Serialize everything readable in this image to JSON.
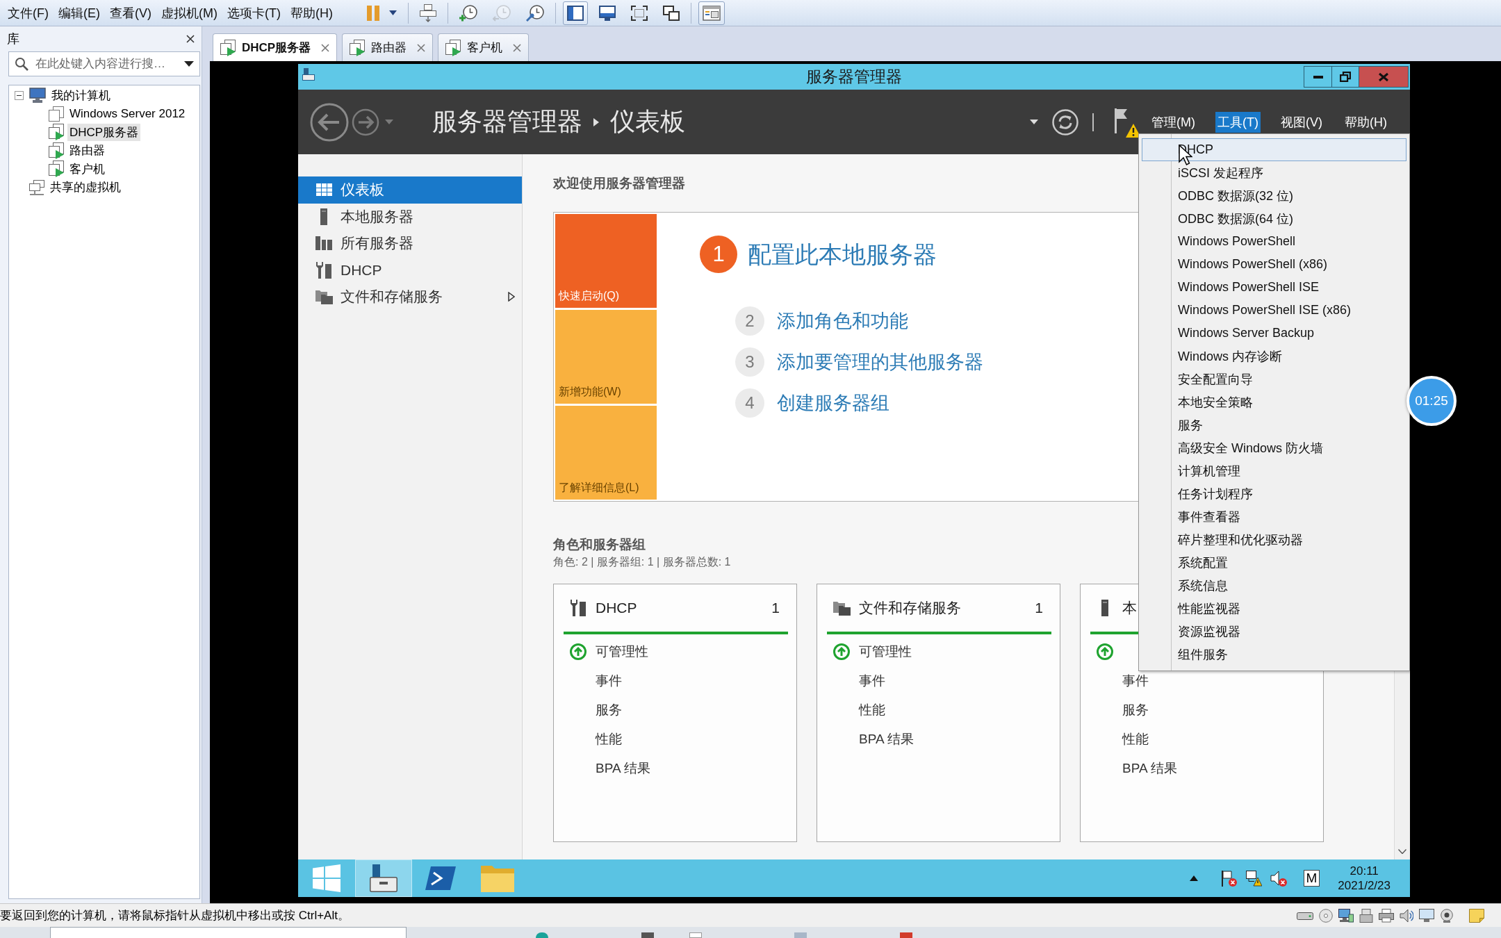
{
  "menu_bar": {
    "items": [
      "文件(F)",
      "编辑(E)",
      "查看(V)",
      "虚拟机(M)",
      "选项卡(T)",
      "帮助(H)"
    ]
  },
  "toolbar": {
    "groups": [
      {
        "buttons": [
          {
            "kind": "pause",
            "selected": false,
            "disabled": false
          }
        ]
      },
      {
        "buttons": [
          {
            "kind": "send-keys",
            "selected": false,
            "disabled": false
          }
        ]
      },
      {
        "buttons": [
          {
            "kind": "snapshot",
            "selected": false,
            "disabled": false
          },
          {
            "kind": "revert",
            "selected": false,
            "disabled": true
          },
          {
            "kind": "snapshot-manager",
            "selected": false,
            "disabled": false
          }
        ]
      },
      {
        "buttons": [
          {
            "kind": "console-view",
            "selected": true,
            "disabled": false
          },
          {
            "kind": "fit-guest",
            "selected": false,
            "disabled": false
          },
          {
            "kind": "full-screen",
            "selected": false,
            "disabled": false
          },
          {
            "kind": "unity",
            "selected": false,
            "disabled": false
          }
        ]
      },
      {
        "buttons": [
          {
            "kind": "thumbnail-bar",
            "selected": true,
            "disabled": false
          }
        ]
      }
    ]
  },
  "library": {
    "title": "库",
    "search": {
      "placeholder": "在此处键入内容进行搜…"
    },
    "tree": [
      {
        "label": "我的计算机",
        "kind": "computer",
        "expanded": true,
        "selected": false,
        "children": [
          {
            "label": "Windows Server 2012",
            "kind": "vm-off",
            "selected": false
          },
          {
            "label": "DHCP服务器",
            "kind": "vm-on",
            "selected": true
          },
          {
            "label": "路由器",
            "kind": "vm-on",
            "selected": false
          },
          {
            "label": "客户机",
            "kind": "vm-on",
            "selected": false
          }
        ]
      },
      {
        "label": "共享的虚拟机",
        "kind": "shared",
        "selected": false
      }
    ]
  },
  "tabs": [
    {
      "label": "DHCP服务器",
      "selected": true
    },
    {
      "label": "路由器",
      "selected": false
    },
    {
      "label": "客户机",
      "selected": false
    }
  ],
  "server_manager": {
    "title": "服务器管理器",
    "breadcrumb": [
      "服务器管理器",
      "仪表板"
    ],
    "notifications": {
      "warning": true
    },
    "menus": [
      {
        "label": "管理(M)",
        "selected": false
      },
      {
        "label": "工具(T)",
        "selected": true
      },
      {
        "label": "视图(V)",
        "selected": false
      },
      {
        "label": "帮助(H)",
        "selected": false
      }
    ],
    "nav": [
      {
        "label": "仪表板",
        "kind": "dashboard",
        "selected": true,
        "submenu": false
      },
      {
        "label": "本地服务器",
        "kind": "server",
        "selected": false,
        "submenu": false
      },
      {
        "label": "所有服务器",
        "kind": "servers",
        "selected": false,
        "submenu": false
      },
      {
        "label": "DHCP",
        "kind": "dhcp",
        "selected": false,
        "submenu": false
      },
      {
        "label": "文件和存储服务",
        "kind": "storage",
        "selected": false,
        "submenu": true
      }
    ],
    "welcome": {
      "title": "欢迎使用服务器管理器",
      "tabs": [
        {
          "label": "快速启动(Q)",
          "selected": true
        },
        {
          "label": "新增功能(W)",
          "selected": false
        },
        {
          "label": "了解详细信息(L)",
          "selected": false
        }
      ],
      "steps": [
        {
          "number": "1",
          "label": "配置此本地服务器",
          "selected": true
        },
        {
          "number": "2",
          "label": "添加角色和功能",
          "selected": false
        },
        {
          "number": "3",
          "label": "添加要管理的其他服务器",
          "selected": false
        },
        {
          "number": "4",
          "label": "创建服务器组",
          "selected": false
        }
      ]
    },
    "roles": {
      "title": "角色和服务器组",
      "summary": "角色: 2 | 服务器组: 1 | 服务器总数: 1",
      "tiles": [
        {
          "title": "DHCP",
          "kind": "dhcp",
          "count": "1",
          "healthy": true,
          "rows": [
            {
              "label": "可管理性",
              "ok": true
            },
            {
              "label": "事件",
              "ok": false
            },
            {
              "label": "服务",
              "ok": false
            },
            {
              "label": "性能",
              "ok": false
            },
            {
              "label": "BPA 结果",
              "ok": false
            }
          ]
        },
        {
          "title": "文件和存储服务",
          "kind": "storage",
          "count": "1",
          "healthy": true,
          "rows": [
            {
              "label": "可管理性",
              "ok": true
            },
            {
              "label": "事件",
              "ok": false
            },
            {
              "label": "性能",
              "ok": false
            },
            {
              "label": "BPA 结果",
              "ok": false
            }
          ]
        },
        {
          "title": "本",
          "kind": "server",
          "healthy": true,
          "rows": [
            {
              "ok": true
            },
            {
              "label": "事件",
              "ok": false
            },
            {
              "label": "服务",
              "ok": false
            },
            {
              "label": "性能",
              "ok": false
            },
            {
              "label": "BPA 结果",
              "ok": false
            }
          ]
        }
      ]
    },
    "tools_menu": [
      {
        "label": "DHCP",
        "selected": true
      },
      {
        "label": "iSCSI 发起程序",
        "selected": false
      },
      {
        "label": "ODBC 数据源(32 位)",
        "selected": false
      },
      {
        "label": "ODBC 数据源(64 位)",
        "selected": false
      },
      {
        "label": "Windows PowerShell",
        "selected": false
      },
      {
        "label": "Windows PowerShell (x86)",
        "selected": false
      },
      {
        "label": "Windows PowerShell ISE",
        "selected": false
      },
      {
        "label": "Windows PowerShell ISE (x86)",
        "selected": false
      },
      {
        "label": "Windows Server Backup",
        "selected": false
      },
      {
        "label": "Windows 内存诊断",
        "selected": false
      },
      {
        "label": "安全配置向导",
        "selected": false
      },
      {
        "label": "本地安全策略",
        "selected": false
      },
      {
        "label": "服务",
        "selected": false
      },
      {
        "label": "高级安全 Windows 防火墙",
        "selected": false
      },
      {
        "label": "计算机管理",
        "selected": false
      },
      {
        "label": "任务计划程序",
        "selected": false
      },
      {
        "label": "事件查看器",
        "selected": false
      },
      {
        "label": "碎片整理和优化驱动器",
        "selected": false
      },
      {
        "label": "系统配置",
        "selected": false
      },
      {
        "label": "系统信息",
        "selected": false
      },
      {
        "label": "性能监视器",
        "selected": false
      },
      {
        "label": "资源监视器",
        "selected": false
      },
      {
        "label": "组件服务",
        "selected": false
      }
    ]
  },
  "recording_timer": {
    "label": "01:25"
  },
  "guest_taskbar": {
    "apps": [
      {
        "kind": "start",
        "selected": false
      },
      {
        "kind": "server-manager",
        "selected": true
      },
      {
        "kind": "powershell",
        "selected": false
      },
      {
        "kind": "explorer",
        "selected": false
      }
    ],
    "tray": {
      "icons": [
        {
          "kind": "show-hidden"
        },
        {
          "kind": "action-center",
          "alert": true
        },
        {
          "kind": "network",
          "alert": true
        },
        {
          "kind": "volume",
          "alert": true
        }
      ],
      "input_method": "M",
      "time": "20:11",
      "date": "2021/2/23"
    }
  },
  "status_bar": {
    "message": "要返回到您的计算机，请将鼠标指针从虚拟机中移出或按 Ctrl+Alt。"
  }
}
